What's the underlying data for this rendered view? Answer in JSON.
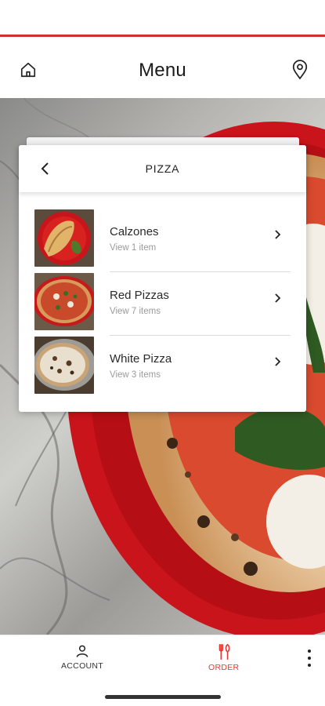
{
  "header": {
    "title": "Menu",
    "home_icon": "home-icon",
    "location_icon": "location-pin-icon"
  },
  "card": {
    "category_title": "PIZZA",
    "back_icon": "chevron-left-icon",
    "items": [
      {
        "name": "Calzones",
        "subtitle": "View 1 item",
        "thumbnail": "calzone-photo"
      },
      {
        "name": "Red Pizzas",
        "subtitle": "View 7 items",
        "thumbnail": "red-pizza-photo"
      },
      {
        "name": "White Pizza",
        "subtitle": "View 3 items",
        "thumbnail": "white-pizza-photo"
      }
    ]
  },
  "bottom_nav": {
    "account_label": "ACCOUNT",
    "order_label": "ORDER",
    "account_icon": "person-icon",
    "order_icon": "fork-knife-icon",
    "more_icon": "more-vertical-icon"
  },
  "colors": {
    "accent": "#e53935",
    "top_line": "#d32f2f"
  }
}
